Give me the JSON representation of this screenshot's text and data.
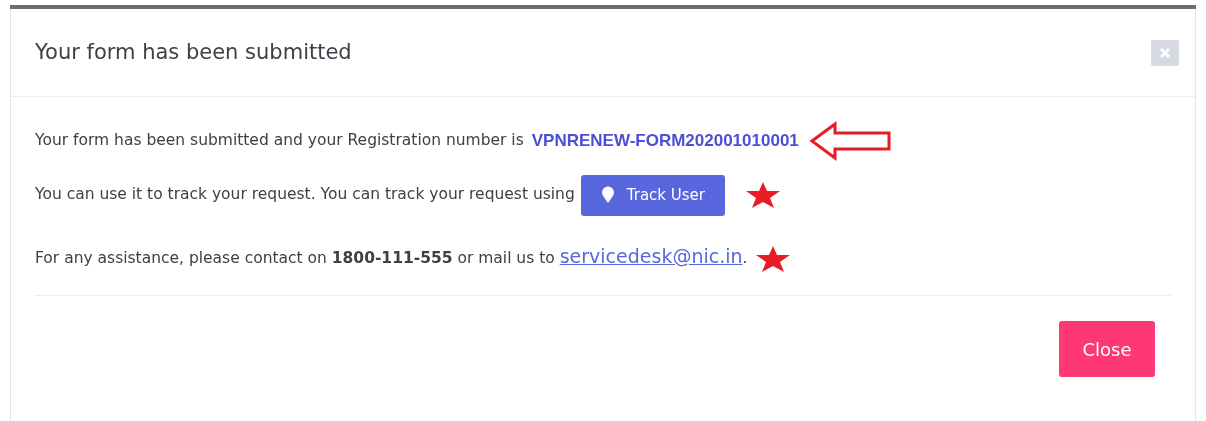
{
  "dialog": {
    "title": "Your form has been submitted",
    "registration": {
      "text": "Your form has been submitted and your Registration number is",
      "number": "VPNRENEW-FORM202001010001"
    },
    "tracking": {
      "text": "You can use it to track your request. You can track your request using",
      "button": "Track User"
    },
    "assistance": {
      "text": "For any assistance, please contact on **1800-111-555** or mail us to",
      "email": "servicedesk@nic.in",
      "tail": "."
    },
    "close_button": "Close"
  }
}
